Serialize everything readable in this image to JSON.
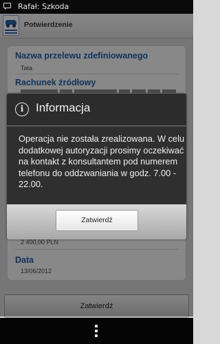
{
  "status_bar": {
    "notification": "Rafał: Szkoda",
    "icon": "message-icon"
  },
  "app_bar": {
    "title": "Potwierdzenie",
    "logo": "bank-logo"
  },
  "fields": [
    {
      "label": "Nazwa przelewu zdefiniowanego",
      "value": "Tata"
    },
    {
      "label": "Rachunek źródłowy",
      "value": ""
    },
    {
      "label": "Data",
      "value": "13/06/2012"
    }
  ],
  "amount_value": "2 400,00 PLN",
  "dialog": {
    "title": "Informacja",
    "icon": "info-icon",
    "message": "Operacja nie została zrealizowana. W celu dodatkowej autoryzacji prosimy oczekiwać na kontakt z konsultantem pod numerem telefonu do oddzwaniania w godz. 7.00 - 22.00.",
    "button": "Zatwierdź"
  },
  "bottom_button": "Zatwierdź",
  "nav_bar": {
    "icon": "overflow-menu-icon"
  }
}
